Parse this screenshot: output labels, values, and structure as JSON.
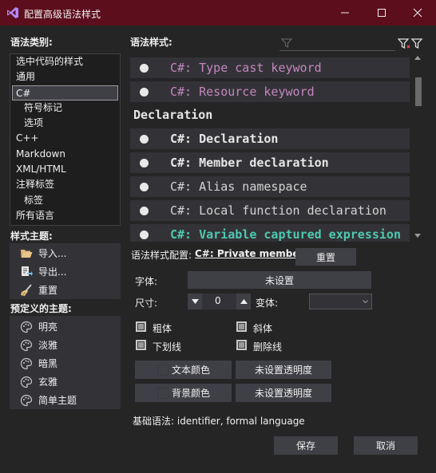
{
  "window": {
    "title": "配置高级语法样式",
    "brand_color": "#5c0e1c"
  },
  "categories": {
    "label": "语法类别:",
    "items": [
      {
        "label": "选中代码的样式",
        "indent": false,
        "selected": false
      },
      {
        "label": "通用",
        "indent": false,
        "selected": false
      },
      {
        "label": "C#",
        "indent": false,
        "selected": true
      },
      {
        "label": "符号标记",
        "indent": true,
        "selected": false
      },
      {
        "label": "选项",
        "indent": true,
        "selected": false
      },
      {
        "label": "C++",
        "indent": false,
        "selected": false
      },
      {
        "label": "Markdown",
        "indent": false,
        "selected": false
      },
      {
        "label": "XML/HTML",
        "indent": false,
        "selected": false
      },
      {
        "label": "注释标签",
        "indent": false,
        "selected": false
      },
      {
        "label": "标签",
        "indent": true,
        "selected": false
      },
      {
        "label": "所有语言",
        "indent": false,
        "selected": false
      }
    ]
  },
  "theme": {
    "label": "样式主题:",
    "import": "导入...",
    "export": "导出...",
    "reset": "重置"
  },
  "predefined": {
    "label": "预定义的主题:",
    "items": [
      "明亮",
      "淡雅",
      "暗黑",
      "玄雅",
      "简单主题"
    ]
  },
  "styles": {
    "label": "语法样式:",
    "section_header": "Declaration",
    "rows_top": [
      {
        "text": "C#: Type cast keyword",
        "color": "#c586c0",
        "bold": false
      },
      {
        "text": "C#: Resource keyword",
        "color": "#c586c0",
        "bold": false
      }
    ],
    "rows_decl": [
      {
        "text": "C#: Declaration",
        "color": "#e6e6e6",
        "bold": true
      },
      {
        "text": "C#: Member declaration",
        "color": "#e6e6e6",
        "bold": true
      },
      {
        "text": "C#: Alias namespace",
        "color": "#d4d4d4",
        "bold": false
      },
      {
        "text": "C#: Local function declaration",
        "color": "#d4d4d4",
        "bold": false
      },
      {
        "text": "C#: Variable captured expression",
        "color": "#4ec9b0",
        "bold": true
      }
    ]
  },
  "config": {
    "label": "语法样式配置:",
    "current": "C#: Private member",
    "reset": "重置",
    "font_label": "字体:",
    "font_value": "未设置",
    "size_label": "尺寸:",
    "size_value": "0",
    "variant_label": "变体:",
    "bold": "粗体",
    "italic": "斜体",
    "underline": "下划线",
    "strikethrough": "删除线",
    "text_color": "文本颜色",
    "text_opacity": "未设置透明度",
    "bg_color": "背景颜色",
    "bg_opacity": "未设置透明度",
    "base_syntax": "基础语法: identifier, formal language"
  },
  "footer": {
    "save": "保存",
    "cancel": "取消"
  }
}
